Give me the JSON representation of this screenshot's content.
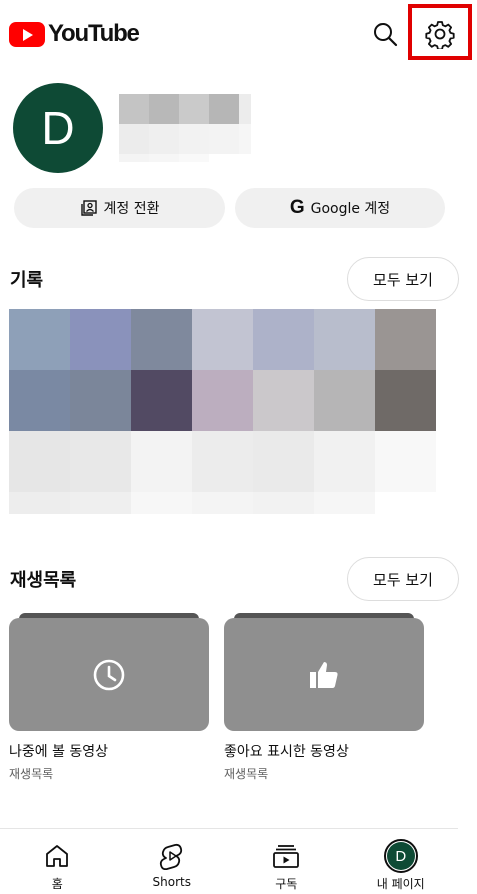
{
  "header": {
    "logo_text": "YouTube",
    "search_icon": "search-icon",
    "settings_icon": "gear-icon",
    "highlight_color": "#e00000"
  },
  "profile": {
    "avatar_letter": "D",
    "avatar_color": "#0e4a35",
    "switch_account_label": "계정 전환",
    "google_account_label": "Google 계정"
  },
  "history": {
    "title": "기록",
    "view_all": "모두 보기"
  },
  "playlists": {
    "title": "재생목록",
    "view_all": "모두 보기",
    "items": [
      {
        "title": "나중에 볼 동영상",
        "subtitle": "재생목록",
        "icon": "clock-icon"
      },
      {
        "title": "좋아요 표시한 동영상",
        "subtitle": "재생목록",
        "icon": "thumbs-up-icon"
      }
    ]
  },
  "bottom_nav": {
    "items": [
      {
        "label": "홈",
        "icon": "home-icon"
      },
      {
        "label": "Shorts",
        "icon": "shorts-icon"
      },
      {
        "label": "구독",
        "icon": "subscriptions-icon"
      },
      {
        "label": "내 페이지",
        "icon": "avatar",
        "avatar_letter": "D"
      }
    ]
  }
}
